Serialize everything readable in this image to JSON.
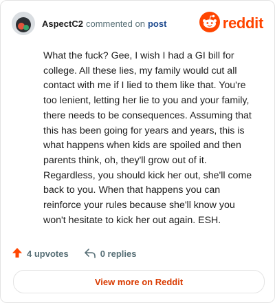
{
  "header": {
    "username": "AspectC2",
    "commented_text": "commented on",
    "post_link": "post",
    "brand": "reddit"
  },
  "comment": {
    "text": "What the fuck? Gee, I wish I had a GI bill for college. All these lies, my family would cut all contact with me if I lied to them like that. You're too lenient, letting her lie to you and your family, there needs to be consequences. Assuming that this has been going for years and years, this is what happens when kids are spoiled and then parents think, oh, they'll grow out of it. Regardless, you should kick her out, she'll come back to you. When that happens you can reinforce your rules because she'll know you won't hesitate to kick her out again. ESH."
  },
  "actions": {
    "upvotes": "4 upvotes",
    "replies": "0 replies"
  },
  "footer": {
    "button_label": "View more on Reddit"
  },
  "colors": {
    "brand": "#ff4500",
    "link": "#1f4b8f",
    "button_text": "#d93a00"
  },
  "icons": [
    "avatar",
    "reddit-logo-icon",
    "upvote-icon",
    "reply-icon"
  ]
}
